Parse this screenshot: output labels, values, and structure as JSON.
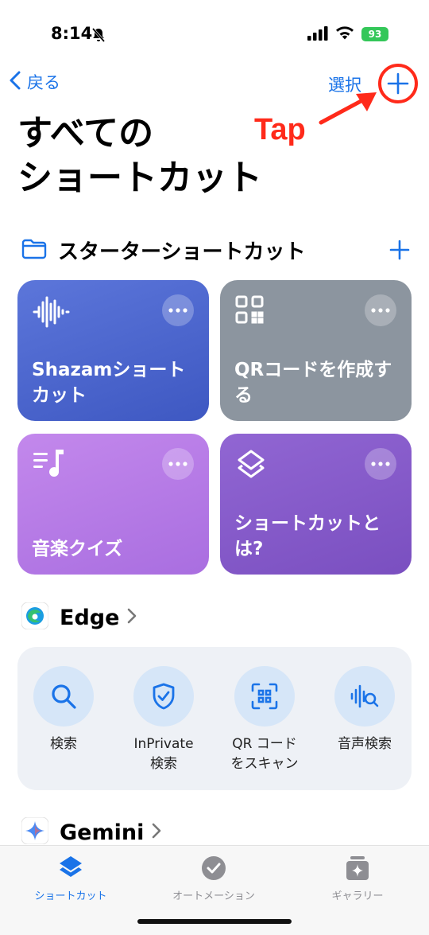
{
  "status_bar": {
    "time": "8:14",
    "battery": "93"
  },
  "nav": {
    "back_label": "戻る",
    "select_label": "選択"
  },
  "annotation": {
    "text": "Tap"
  },
  "page_title": "すべての\nショートカット",
  "starter": {
    "title": "スターターショートカット",
    "cards": [
      {
        "label": "Shazamショートカット",
        "icon": "waveform-icon"
      },
      {
        "label": "QRコードを作成する",
        "icon": "qrcode-icon"
      },
      {
        "label": "音楽クイズ",
        "icon": "music-list-icon"
      },
      {
        "label": "ショートカットとは?",
        "icon": "stack-icon"
      }
    ]
  },
  "edge": {
    "title": "Edge",
    "actions": [
      {
        "label": "検索",
        "icon": "search-icon"
      },
      {
        "label": "InPrivate\n検索",
        "icon": "shield-check-icon"
      },
      {
        "label": "QR コード\nをスキャン",
        "icon": "qr-scan-icon"
      },
      {
        "label": "音声検索",
        "icon": "voice-search-icon"
      }
    ]
  },
  "gemini": {
    "title": "Gemini"
  },
  "tabbar": {
    "items": [
      {
        "label": "ショートカット",
        "active": true
      },
      {
        "label": "オートメーション",
        "active": false
      },
      {
        "label": "ギャラリー",
        "active": false
      }
    ]
  },
  "colors": {
    "accent": "#1a73e8",
    "annotation": "#ff2a1a"
  }
}
